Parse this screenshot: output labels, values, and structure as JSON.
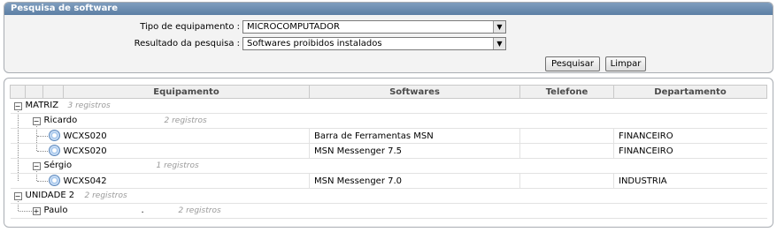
{
  "search_panel": {
    "title": "Pesquisa de software",
    "fields": [
      {
        "label": "Tipo de equipamento :",
        "value": "MICROCOMPUTADOR"
      },
      {
        "label": "Resultado da pesquisa :",
        "value": "Softwares proibidos instalados"
      }
    ],
    "buttons": {
      "search": "Pesquisar",
      "clear": "Limpar"
    }
  },
  "results": {
    "columns": [
      "Equipamento",
      "Softwares",
      "Telefone",
      "Departamento"
    ],
    "groups": [
      {
        "name": "MATRIZ",
        "count": "3 registros",
        "users": [
          {
            "name": "Ricardo",
            "count": "2 registros",
            "rows": [
              {
                "equipment": "WCXS020",
                "software": "Barra de Ferramentas MSN",
                "phone": "",
                "department": "FINANCEIRO"
              },
              {
                "equipment": "WCXS020",
                "software": "MSN Messenger 7.5",
                "phone": "",
                "department": "FINANCEIRO"
              }
            ]
          },
          {
            "name": "Sérgio",
            "count": "1 registros",
            "rows": [
              {
                "equipment": "WCXS042",
                "software": "MSN Messenger 7.0",
                "phone": "",
                "department": "INDUSTRIA"
              }
            ]
          }
        ]
      },
      {
        "name": "UNIDADE 2",
        "count": "2 registros",
        "users": [
          {
            "name": "Paulo",
            "suffix": ".",
            "count": "2 registros",
            "rows": []
          }
        ]
      }
    ]
  },
  "icons": {
    "expanded": "minus-box-icon",
    "collapsed": "plus-box-icon",
    "equipment": "cd-disc-icon"
  },
  "colors": {
    "title_bar": "#5c7fa4",
    "count_text": "#9a9a9a"
  }
}
